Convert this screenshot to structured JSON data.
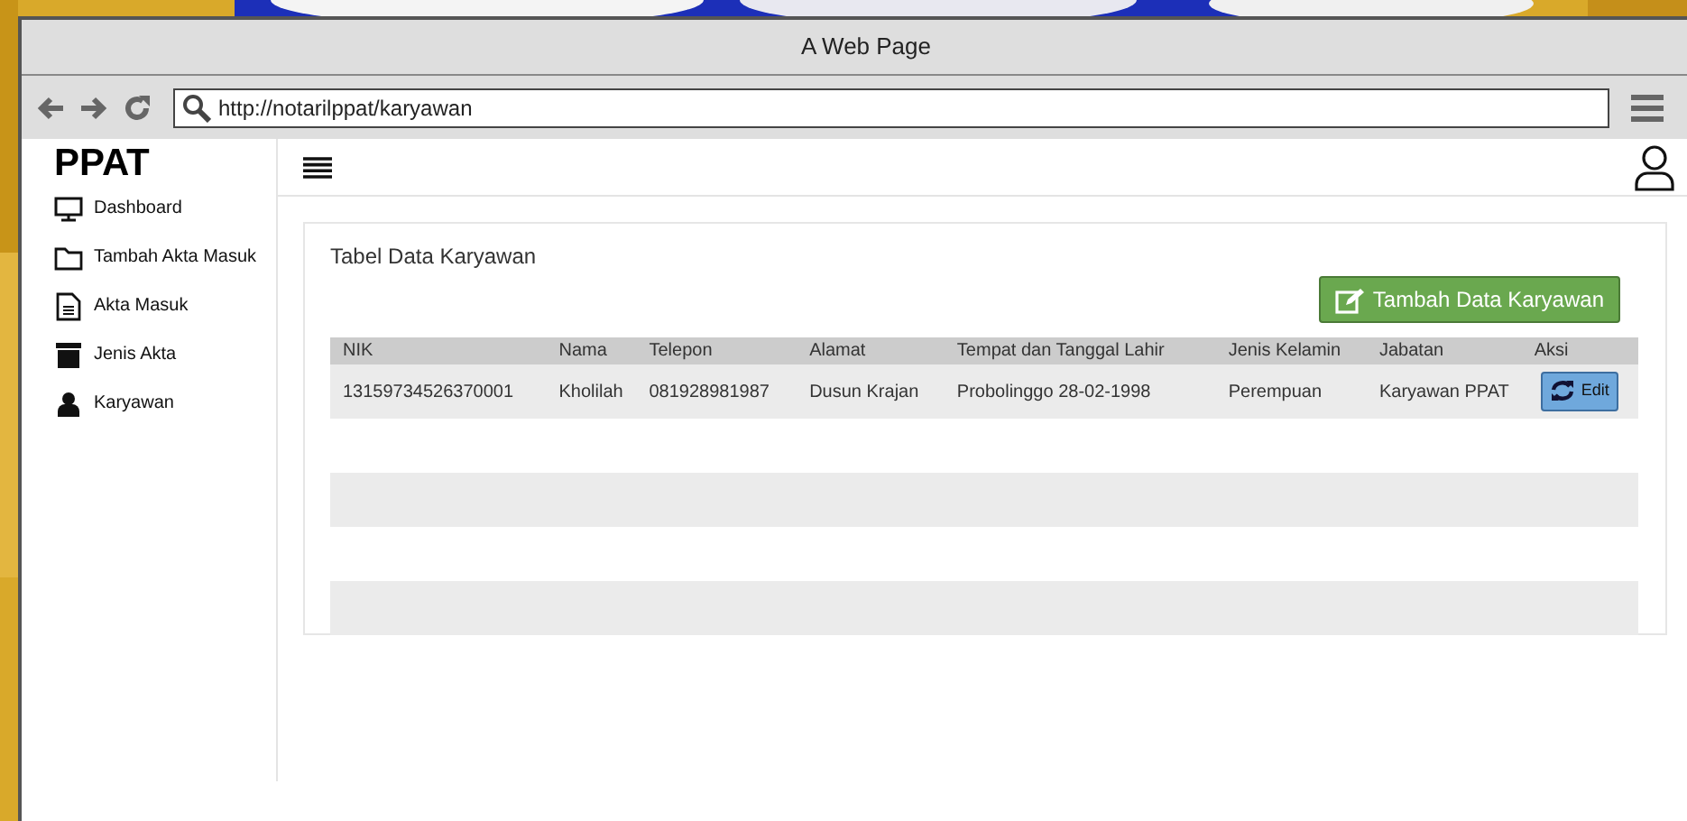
{
  "window": {
    "title": "A Web Page"
  },
  "browser": {
    "url": "http://notarilppat/karyawan"
  },
  "sidebar": {
    "logo": "PPAT",
    "items": [
      {
        "label": "Dashboard",
        "kind": "monitor"
      },
      {
        "label": "Tambah Akta Masuk",
        "kind": "folder"
      },
      {
        "label": "Akta Masuk",
        "kind": "document"
      },
      {
        "label": "Jenis Akta",
        "kind": "archive"
      },
      {
        "label": "Karyawan",
        "kind": "user"
      }
    ]
  },
  "panel": {
    "title": "Tabel Data Karyawan",
    "add_button": "Tambah Data Karyawan"
  },
  "table": {
    "columns": [
      "NIK",
      "Nama",
      "Telepon",
      "Alamat",
      "Tempat dan Tanggal Lahir",
      "Jenis Kelamin",
      "Jabatan",
      "Aksi"
    ],
    "rows": [
      {
        "cells": [
          "13159734526370001",
          "Kholilah",
          "081928981987",
          "Dusun Krajan",
          "Probolinggo 28-02-1998",
          "Perempuan",
          "Karyawan PPAT"
        ],
        "action": "Edit"
      }
    ]
  }
}
